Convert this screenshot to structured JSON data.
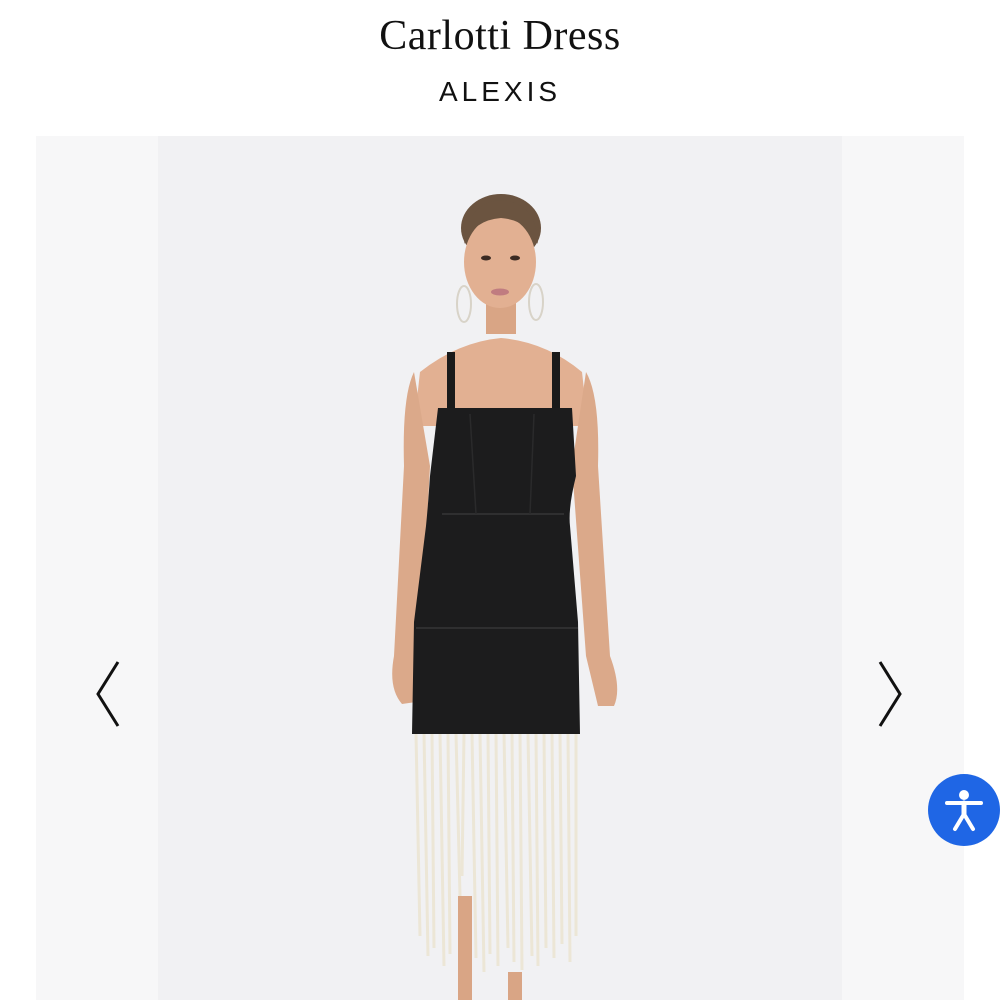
{
  "product": {
    "title": "Carlotti Dress",
    "brand": "ALEXIS"
  },
  "gallery": {
    "image_icon": "model-wearing-black-dress-with-fringe-hem",
    "prev_icon": "chevron-left-icon",
    "next_icon": "chevron-right-icon"
  },
  "accessibility": {
    "icon": "accessibility-person-icon",
    "color": "#1f66e5"
  }
}
